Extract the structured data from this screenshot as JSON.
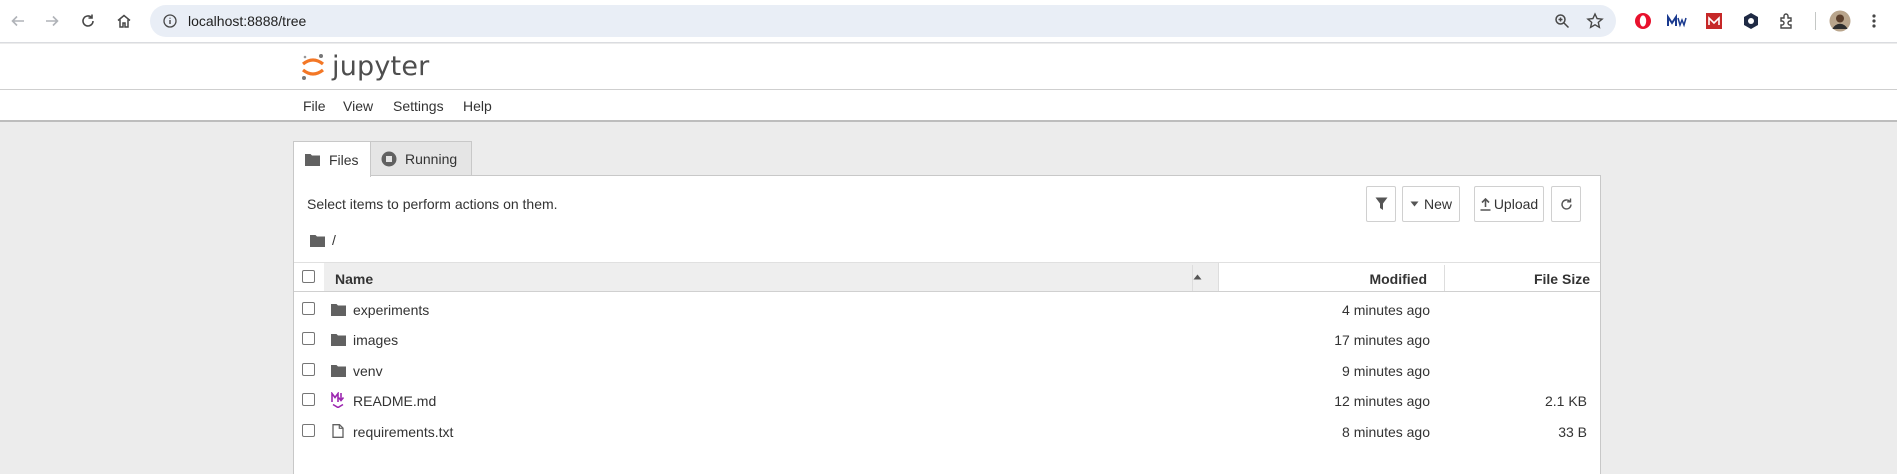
{
  "browser": {
    "url": "localhost:8888/tree"
  },
  "jupyter": {
    "logo_text": "jupyter",
    "menu": [
      "File",
      "View",
      "Settings",
      "Help"
    ],
    "tabs": [
      {
        "label": "Files",
        "active": true
      },
      {
        "label": "Running",
        "active": false
      }
    ]
  },
  "panel": {
    "hint": "Select items to perform actions on them.",
    "toolbar": {
      "new_label": "New",
      "upload_label": "Upload"
    },
    "breadcrumb": "/",
    "columns": {
      "name": "Name",
      "modified": "Modified",
      "size": "File Size"
    },
    "rows": [
      {
        "name": "experiments",
        "modified": "4 minutes ago",
        "size": "",
        "icon": "folder-icon"
      },
      {
        "name": "images",
        "modified": "17 minutes ago",
        "size": "",
        "icon": "folder-icon"
      },
      {
        "name": "venv",
        "modified": "9 minutes ago",
        "size": "",
        "icon": "folder-icon"
      },
      {
        "name": "README.md",
        "modified": "12 minutes ago",
        "size": "2.1 KB",
        "icon": "markdown-icon"
      },
      {
        "name": "requirements.txt",
        "modified": "8 minutes ago",
        "size": "33 B",
        "icon": "text-file-icon"
      }
    ]
  },
  "colors": {
    "jupyter_orange": "#f37726",
    "markdown_purple": "#9c27b0",
    "urlbar_bg": "#e9eef6"
  }
}
